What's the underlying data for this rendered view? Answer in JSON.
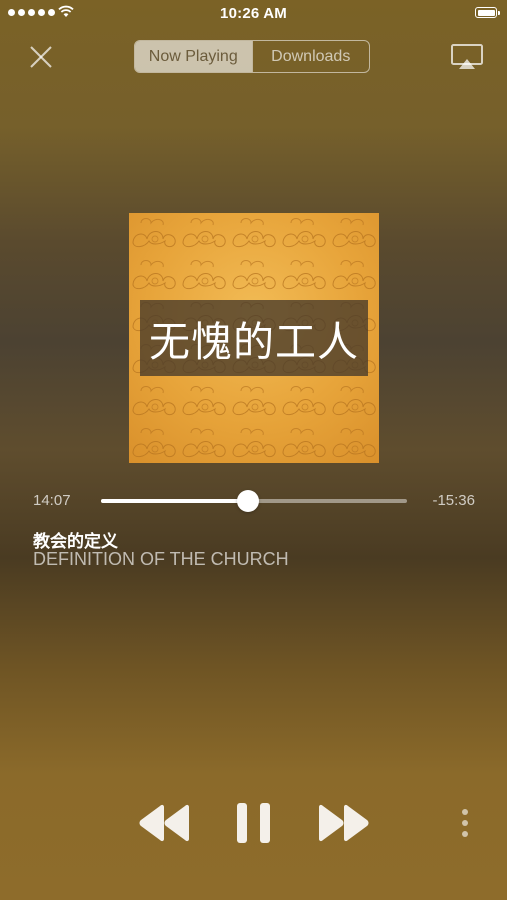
{
  "status_bar": {
    "time": "10:26 AM"
  },
  "top_bar": {
    "tabs": [
      {
        "label": "Now Playing",
        "active": true
      },
      {
        "label": "Downloads",
        "active": false
      }
    ]
  },
  "artwork": {
    "title": "无愧的工人"
  },
  "progress": {
    "elapsed": "14:07",
    "remaining": "-15:36",
    "fraction": 0.48
  },
  "track": {
    "title": "教会的定义",
    "subtitle": "DEFINITION OF THE CHURCH"
  },
  "controls": {
    "icons": [
      "rewind-icon",
      "pause-icon",
      "fast-forward-icon",
      "more-vertical-icon"
    ]
  },
  "colors": {
    "accent": "#ffffff",
    "artwork": "#e7a43a",
    "background": "#6e5a2c"
  }
}
